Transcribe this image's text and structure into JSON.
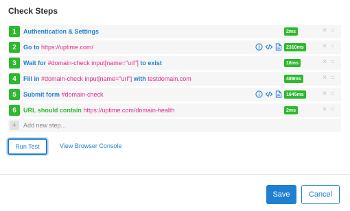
{
  "title": "Check Steps",
  "steps": [
    {
      "num": "1",
      "parts": [
        {
          "t": "Authentication & Settings"
        }
      ],
      "time": "2ms"
    },
    {
      "num": "2",
      "parts": [
        {
          "t": "Go to "
        },
        {
          "t": "https://uptime.com/",
          "hl": true
        }
      ],
      "time": "2310ms",
      "icons": [
        "info-icon",
        "code-icon",
        "file-icon"
      ]
    },
    {
      "num": "3",
      "parts": [
        {
          "t": "Wait for "
        },
        {
          "t": "#domain-check input[name=\"url\"]",
          "hl": true
        },
        {
          "t": " to exist"
        }
      ],
      "time": "18ms"
    },
    {
      "num": "4",
      "parts": [
        {
          "t": "Fill in "
        },
        {
          "t": "#domain-check input[name=\"url\"]",
          "hl": true
        },
        {
          "t": " with "
        },
        {
          "t": "testdomain.com",
          "hl": true
        }
      ],
      "time": "489ms"
    },
    {
      "num": "5",
      "parts": [
        {
          "t": "Submit form "
        },
        {
          "t": "#domain-check",
          "hl": true
        }
      ],
      "time": "1645ms",
      "icons": [
        "info-icon",
        "code-icon",
        "file-icon"
      ]
    },
    {
      "num": "6",
      "parts": [
        {
          "t": "URL should contain "
        },
        {
          "t": "https://uptime.com/domain-health",
          "hl": true
        }
      ],
      "time": "2ms",
      "green": true
    }
  ],
  "add_step": {
    "plus": "+",
    "placeholder": "Add new step..."
  },
  "run_test": "Run Test",
  "view_console": "View Browser Console",
  "save": "Save",
  "cancel": "Cancel",
  "row_controls": {
    "remove": "✕",
    "drag": "="
  },
  "colors": {
    "accent": "#1f7fd1",
    "success": "#2eb82e",
    "highlight": "#e0288a"
  }
}
